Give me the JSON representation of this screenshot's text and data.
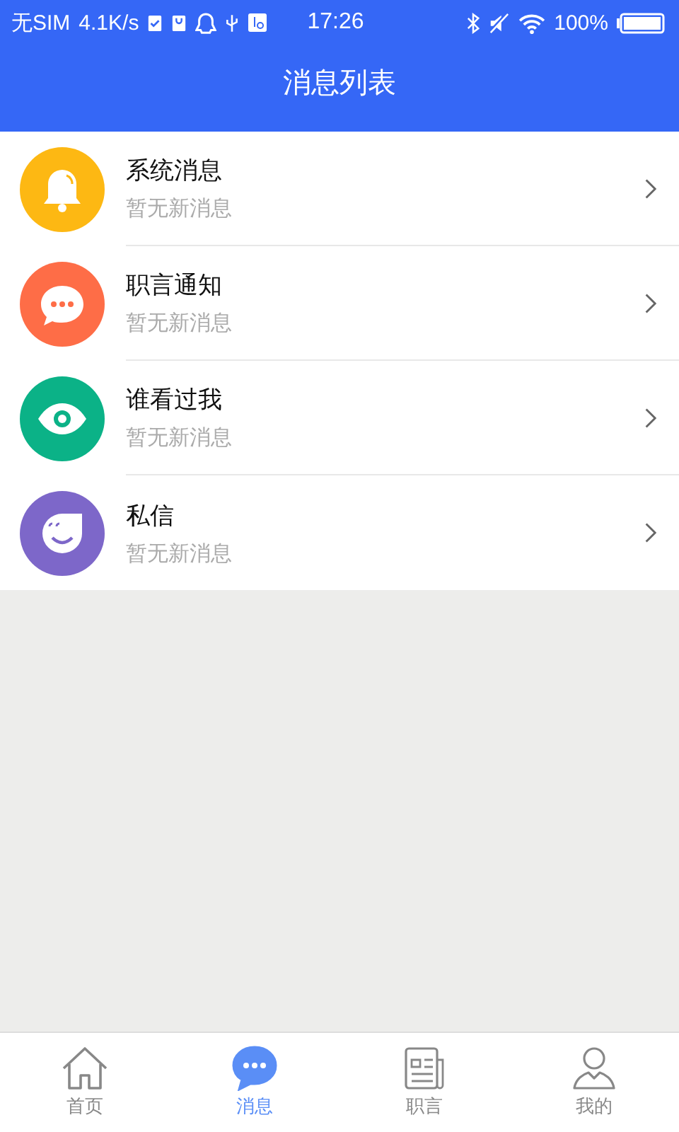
{
  "status_bar": {
    "carrier": "无SIM",
    "speed": "4.1K/s",
    "time": "17:26",
    "battery": "100%"
  },
  "header": {
    "title": "消息列表"
  },
  "messages": [
    {
      "kind": "bell",
      "color": "#fdb813",
      "title": "系统消息",
      "subtitle": "暂无新消息"
    },
    {
      "kind": "chat",
      "color": "#fe6d47",
      "title": "职言通知",
      "subtitle": "暂无新消息"
    },
    {
      "kind": "eye",
      "color": "#0bb287",
      "title": "谁看过我",
      "subtitle": "暂无新消息"
    },
    {
      "kind": "smile",
      "color": "#7d67c9",
      "title": "私信",
      "subtitle": "暂无新消息"
    }
  ],
  "tabs": [
    {
      "kind": "home",
      "label": "首页",
      "selected": false
    },
    {
      "kind": "chat",
      "label": "消息",
      "selected": true
    },
    {
      "kind": "news",
      "label": "职言",
      "selected": false
    },
    {
      "kind": "person",
      "label": "我的",
      "selected": false
    }
  ]
}
